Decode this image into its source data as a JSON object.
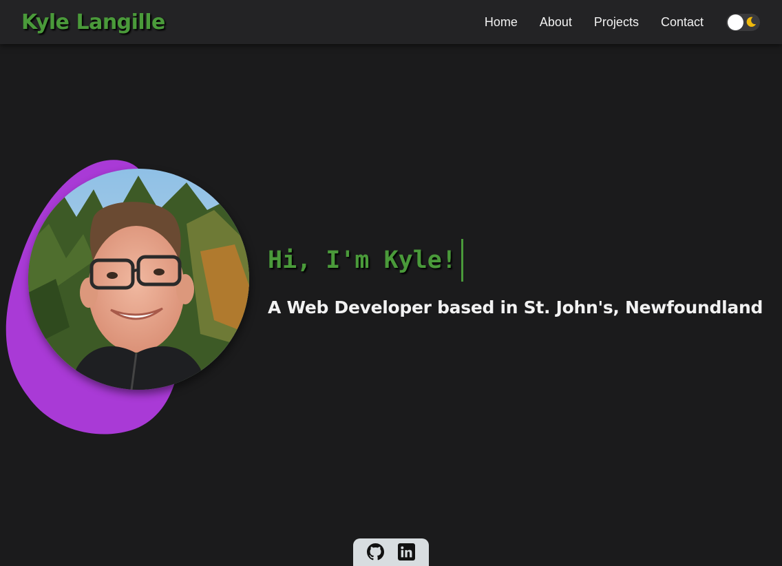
{
  "nav": {
    "brand": "Kyle Langille",
    "links": [
      {
        "label": "Home"
      },
      {
        "label": "About"
      },
      {
        "label": "Projects"
      },
      {
        "label": "Contact"
      }
    ],
    "theme_toggle": {
      "state": "dark",
      "knob_icon": "sun-knob",
      "icon": "moon-icon"
    }
  },
  "hero": {
    "greeting": "Hi, I'm Kyle!",
    "subtitle": "A Web Developer based in St. John's, Newfoundland",
    "photo_alt": "Photo of Kyle Langille"
  },
  "social": {
    "links": [
      {
        "icon": "github-icon"
      },
      {
        "icon": "linkedin-icon"
      }
    ]
  },
  "colors": {
    "background": "#1b1b1c",
    "navbar": "#232325",
    "accent_green": "#4a9a3a",
    "blob_purple": "#a93ad6",
    "moon_yellow": "#f0b90b",
    "social_tab": "#d8dde0",
    "text": "#f2f2f2"
  }
}
